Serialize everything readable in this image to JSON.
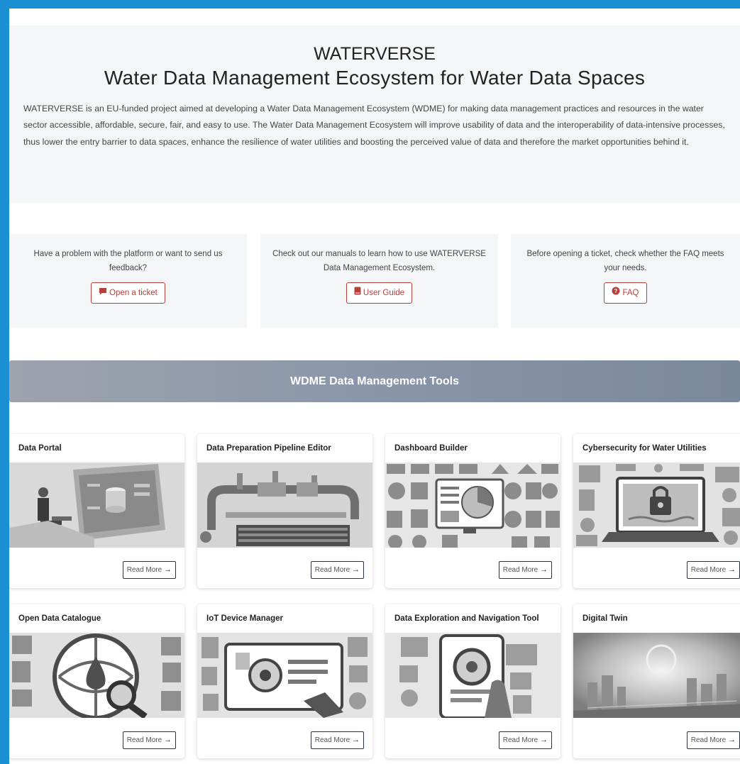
{
  "hero": {
    "title": "WATERVERSE",
    "subtitle": "Water Data Management Ecosystem for Water Data Spaces",
    "description": "WATERVERSE is an EU-funded project aimed at developing a Water Data Management Ecosystem (WDME) for making data management practices and resources in the water sector accessible, affordable, secure, fair, and easy to use. The Water Data Management Ecosystem will improve usability of data and the interoperability of data-intensive processes, thus lower the entry barrier to data spaces, enhance the resilience of water utilities and boosting the perceived value of data and therefore the market opportunities behind it."
  },
  "help": [
    {
      "text": "Have a problem with the platform or want to send us feedback?",
      "button": "Open a ticket",
      "icon": "comment-icon"
    },
    {
      "text": "Check out our manuals to learn how to use WATERVERSE Data Management Ecosystem.",
      "button": "User Guide",
      "icon": "book-icon"
    },
    {
      "text": "Before opening a ticket, check whether the FAQ meets your needs.",
      "button": "FAQ",
      "icon": "question-circle-icon"
    }
  ],
  "banner": {
    "title": "WDME Data Management Tools"
  },
  "tools": [
    {
      "title": "Data Portal",
      "button": "Read More",
      "arrow": "→"
    },
    {
      "title": "Data Preparation Pipeline Editor",
      "button": "Read More",
      "arrow": "→"
    },
    {
      "title": "Dashboard Builder",
      "button": "Read More",
      "arrow": "→"
    },
    {
      "title": "Cybersecurity for Water Utilities",
      "button": "Read More",
      "arrow": "→"
    },
    {
      "title": "Open Data Catalogue",
      "button": "Read More",
      "arrow": "→"
    },
    {
      "title": "IoT Device Manager",
      "button": "Read More",
      "arrow": "→"
    },
    {
      "title": "Data Exploration and Navigation Tool",
      "button": "Read More",
      "arrow": "→"
    },
    {
      "title": "Digital Twin",
      "button": "Read More",
      "arrow": "→"
    }
  ],
  "colors": {
    "accent": "#b5403a",
    "frame": "#1b8fd3",
    "banner": "#8b97aa"
  }
}
